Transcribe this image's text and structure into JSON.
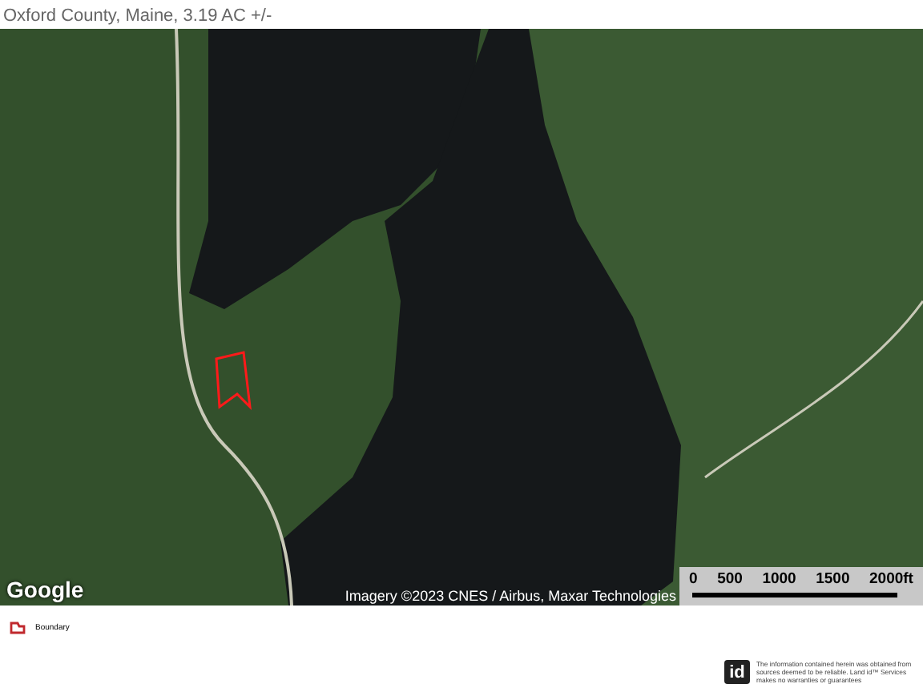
{
  "header": {
    "subtitle": "Oxford County, Maine, 3.19 AC +/-"
  },
  "map": {
    "logo": "Google",
    "attribution": "Imagery ©2023 CNES / Airbus, Maxar Technologies",
    "scale_labels": [
      "0",
      "500",
      "1000",
      "1500",
      "2000ft"
    ]
  },
  "legend": [
    {
      "label": "Boundary",
      "color": "#c0282d"
    }
  ],
  "footer": {
    "logo": "id",
    "disclaimer": "The information contained herein was obtained from sources deemed to be reliable. Land id™ Services makes no warranties or guarantees"
  }
}
